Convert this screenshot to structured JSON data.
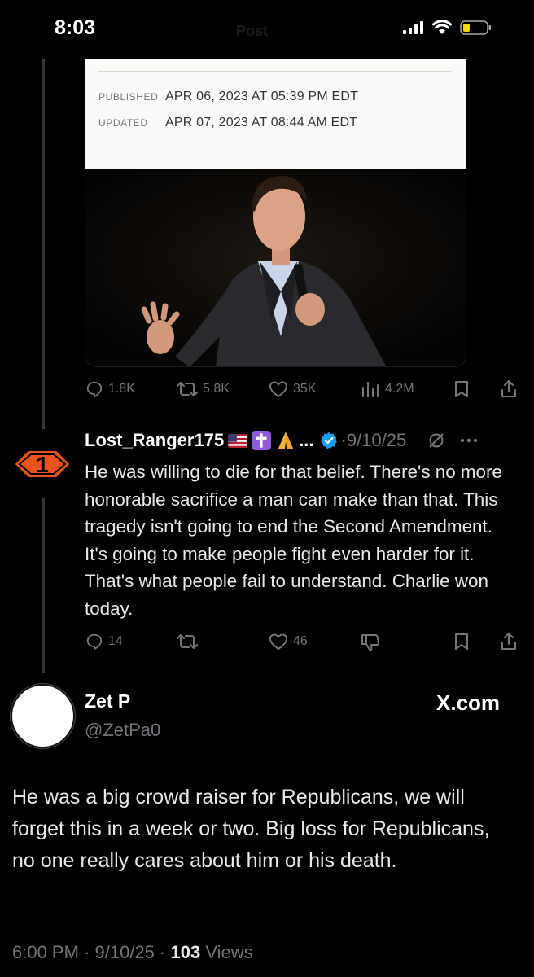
{
  "status_bar": {
    "time": "8:03",
    "faded_title": "Post"
  },
  "article": {
    "published_label": "PUBLISHED",
    "published_value": "APR 06, 2023 AT 05:39 PM EDT",
    "updated_label": "UPDATED",
    "updated_value": "APR 07, 2023 AT 08:44 AM EDT"
  },
  "photo": {
    "icon": "speaker-photo"
  },
  "post_actions": {
    "replies": "1.8K",
    "reposts": "5.8K",
    "likes": "35K",
    "views": "4.2M"
  },
  "reply": {
    "badge_number": "1",
    "name": "Lost_Ranger175",
    "name_suffix": "...",
    "date": "9/10/25",
    "text": "He was willing to die for that belief.  There's no more honorable sacrifice a man can make than that. This tragedy isn't going to end the Second Amendment. It's going to make people fight even harder for it. That's what people fail to understand. Charlie won today.",
    "replies": "14",
    "likes": "46"
  },
  "quote": {
    "name": "Zet P",
    "handle": "@ZetPa0",
    "source": "X.com",
    "text": "He was a big crowd raiser for Republicans, we will forget this in a week or two. Big loss for Republicans, no one really cares about him or his death.",
    "time": "6:00 PM",
    "date": "9/10/25",
    "views_count": "103",
    "views_label": "Views"
  },
  "colors": {
    "background": "#000000",
    "text": "#e7e9ea",
    "muted": "#71767b",
    "verified": "#1d9bf0",
    "badge": "#e8541c"
  }
}
